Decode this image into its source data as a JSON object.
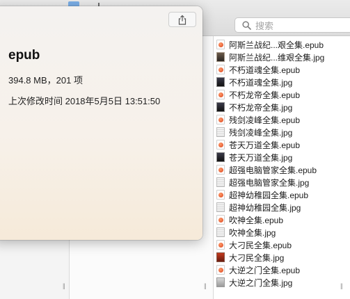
{
  "search": {
    "placeholder": "搜索",
    "icon": "search-icon"
  },
  "popover": {
    "title": "epub",
    "size_line": "394.8 MB，201 项",
    "modified_line": "上次修改时间 2018年5月5日 13:51:50",
    "share_icon": "share-icon"
  },
  "files": [
    {
      "name": "阿斯兰战纪...艰全集.epub",
      "kind": "epub"
    },
    {
      "name": "阿斯兰战纪...维艰全集.jpg",
      "kind": "jpg-cover"
    },
    {
      "name": "不朽道魂全集.epub",
      "kind": "epub"
    },
    {
      "name": "不朽道魂全集.jpg",
      "kind": "jpg-dark"
    },
    {
      "name": "不朽龙帝全集.epub",
      "kind": "epub"
    },
    {
      "name": "不朽龙帝全集.jpg",
      "kind": "jpg-dark"
    },
    {
      "name": "残剑凌峰全集.epub",
      "kind": "epub"
    },
    {
      "name": "残剑凌峰全集.jpg",
      "kind": "jpg-light"
    },
    {
      "name": "苍天万道全集.epub",
      "kind": "epub"
    },
    {
      "name": "苍天万道全集.jpg",
      "kind": "jpg-dark"
    },
    {
      "name": "超强电脑管家全集.epub",
      "kind": "epub"
    },
    {
      "name": "超强电脑管家全集.jpg",
      "kind": "jpg-light"
    },
    {
      "name": "超神幼稚园全集.epub",
      "kind": "epub"
    },
    {
      "name": "超神幼稚园全集.jpg",
      "kind": "jpg-light"
    },
    {
      "name": "吹神全集.epub",
      "kind": "epub"
    },
    {
      "name": "吹神全集.jpg",
      "kind": "jpg-light"
    },
    {
      "name": "大刁民全集.epub",
      "kind": "epub"
    },
    {
      "name": "大刁民全集.jpg",
      "kind": "jpg-red"
    },
    {
      "name": "大逆之门全集.epub",
      "kind": "epub"
    },
    {
      "name": "大逆之门全集.jpg",
      "kind": "jpg-gray"
    }
  ],
  "colors": {
    "accent": "#7aaee6",
    "epub_icon": "#d8421d"
  }
}
